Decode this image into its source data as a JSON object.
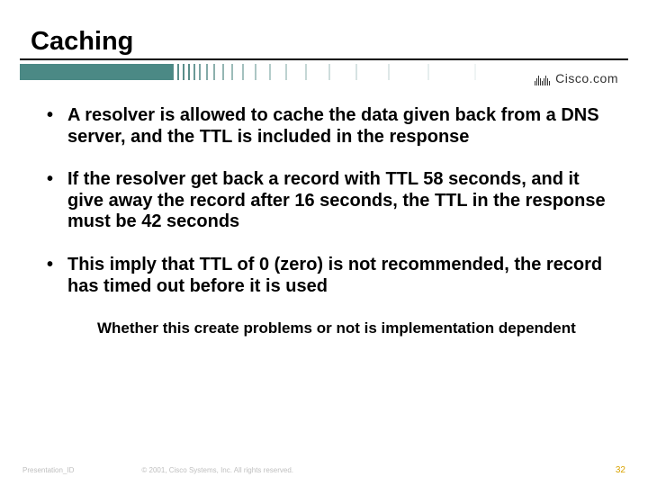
{
  "title": "Caching",
  "logo": {
    "name": "Cisco.com",
    "url": ""
  },
  "bullets": [
    "A resolver is allowed to cache the data given back from a DNS server, and the TTL is included in the response",
    "If the resolver get back a record with TTL 58 seconds, and it give away the record after 16 seconds, the TTL in the response must be 42 seconds",
    "This imply that TTL of 0 (zero) is not recommended, the record has timed out before it is used"
  ],
  "sub_bullet": "Whether this create problems or not is implementation dependent",
  "footer": {
    "presentation_id": "Presentation_ID",
    "copyright": "© 2001, Cisco Systems, Inc. All rights reserved.",
    "page": "32"
  }
}
